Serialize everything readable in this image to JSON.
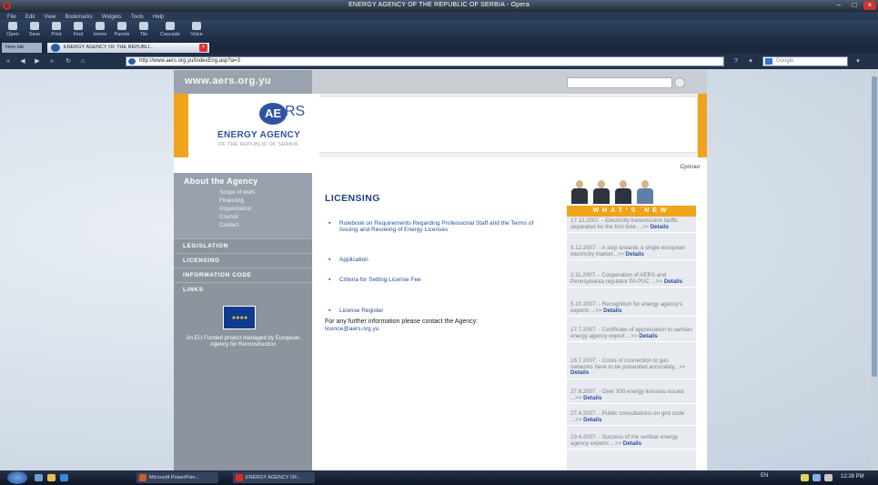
{
  "window": {
    "title": "ENERGY AGENCY OF THE REPUBLIC OF SERBIA - Opera"
  },
  "menu": [
    "File",
    "Edit",
    "View",
    "Bookmarks",
    "Widgets",
    "Tools",
    "Help"
  ],
  "toolbar": [
    "Open",
    "Save",
    "Print",
    "Find",
    "Home",
    "Panels",
    "Tile",
    "Cascade",
    "Voice"
  ],
  "tabs": {
    "new_tab": "New tab",
    "active": "ENERGY AGENCY OF THE REPUBLI..."
  },
  "address": {
    "url": "http://www.aers.org.yu/indexEng.asp?a=3",
    "search_placeholder": "Google"
  },
  "site": {
    "url_mark": "www.aers.org.yu",
    "logo_ae": "AE",
    "logo_rs": "RS",
    "logo_name": "ENERGY AGENCY",
    "logo_sub": "OF THE REPUBLIC OF SERBIA",
    "language_link": "Српски"
  },
  "sidebar": {
    "section_title": "About the Agency",
    "sub_items": [
      "Scope of work",
      "Financing",
      "Organization",
      "Council",
      "Contact"
    ],
    "items": [
      "LEGISLATION",
      "LICENSING",
      "INFORMATION CODE",
      "LINKS"
    ],
    "eu_text": "An EU Funded project managed by European Agency for Reconstruction"
  },
  "content": {
    "heading": "LICENSING",
    "links": [
      "Rulebook on Requirements Regarding Professional Staff and the Terms of Issuing and Revoking of Energy Licenses",
      "Application",
      "Criteria for Setting License Fee",
      "License Register"
    ],
    "info": "For any further information please contact the Agency:",
    "email": "licence@aers.org.yu"
  },
  "news": {
    "header": "WHAT'S NEW",
    "details_label": "Details",
    "items": [
      {
        "text": "17.12.2007. - Electricity transmission tariffs separated for the first time ...>> "
      },
      {
        "text": "3.12.2007. - A step towards a single european electricity market...>> "
      },
      {
        "text": "2.11.2007. - Cooperation of AERS and Pennsylvania regulator PA PUC ...>> "
      },
      {
        "text": "5.10.2007. - Recognition for energy agency's experts ...>> "
      },
      {
        "text": "17.7.2007. - Certificate of appreciation to serbian energy agency expert ...>> "
      },
      {
        "text": "16.7.2007. - Costs of connection to gas networks have to be presented accurately...>> "
      },
      {
        "text": "27.6.2007. - Over 300 energy licenses issued ...>> "
      },
      {
        "text": "27.4.2007. - Public consultations on grid code ...>> "
      },
      {
        "text": "19.4.2007. - Success of the serbian energy agency experts ...>> "
      }
    ]
  },
  "taskbar": {
    "tasks": [
      "Microsoft PowerPoin...",
      "ENERGY AGENCY OF..."
    ],
    "language": "EN",
    "clock": "12:28 PM"
  },
  "colors": {
    "accent_orange": "#f1a31b",
    "brand_blue": "#2f53a3",
    "sidebar_gray": "#8c949e"
  }
}
